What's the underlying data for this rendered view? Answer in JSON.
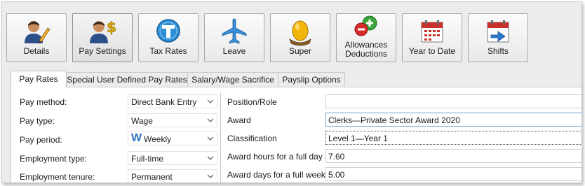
{
  "toolbar": {
    "buttons": [
      {
        "label": "Details",
        "icon": "person-pencil-icon"
      },
      {
        "label": "Pay Settings",
        "icon": "person-dollar-icon"
      },
      {
        "label": "Tax Rates",
        "icon": "tax-t-icon"
      },
      {
        "label": "Leave",
        "icon": "airplane-icon"
      },
      {
        "label": "Super",
        "icon": "nest-egg-icon"
      },
      {
        "label": "Allowances Deductions",
        "label_line1": "Allowances",
        "label_line2": "Deductions",
        "icon": "plus-minus-icon"
      },
      {
        "label": "Year to Date",
        "icon": "calendar-icon"
      },
      {
        "label": "Shifts",
        "icon": "shift-calendar-icon"
      }
    ],
    "active": "Pay Settings"
  },
  "tabs": [
    {
      "label": "Pay Rates"
    },
    {
      "label": "Special User Defined Pay Rates"
    },
    {
      "label": "Salary/Wage Sacrifice"
    },
    {
      "label": "Payslip Options"
    }
  ],
  "left_form": {
    "pay_method": {
      "label": "Pay method:",
      "value": "Direct Bank Entry"
    },
    "pay_type": {
      "label": "Pay type:",
      "value": "Wage"
    },
    "pay_period": {
      "label": "Pay period:",
      "value": "Weekly",
      "badge": "W"
    },
    "employment_type": {
      "label": "Employment type:",
      "value": "Full-time"
    },
    "employment_tenure": {
      "label": "Employment tenure:",
      "value": "Permanent"
    }
  },
  "right_form": {
    "position_role": {
      "label": "Position/Role",
      "value": ""
    },
    "award": {
      "label": "Award",
      "value": "Clerks—Private Sector Award 2020"
    },
    "classification": {
      "label": "Classification",
      "value": "Level 1—Year 1"
    },
    "award_hours": {
      "label": "Award hours for a full day",
      "value": "7.60"
    },
    "award_days": {
      "label": "Award days for a full week",
      "value": "5.00"
    }
  },
  "colors": {
    "accent_blue": "#2b6fc0",
    "selection_border": "#6f9fd0"
  }
}
